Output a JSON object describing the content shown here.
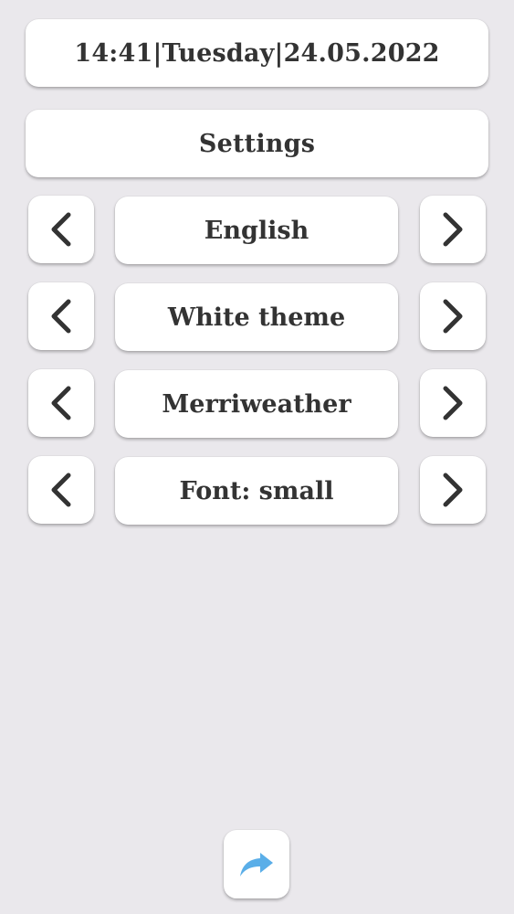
{
  "header": {
    "datetime": "14:41|Tuesday|24.05.2022"
  },
  "title": "Settings",
  "settings": [
    {
      "label": "English"
    },
    {
      "label": "White theme"
    },
    {
      "label": "Merriweather"
    },
    {
      "label": "Font: small"
    }
  ],
  "icons": {
    "previous": "chevron-left-icon",
    "next": "chevron-right-icon",
    "share": "share-arrow-icon"
  },
  "colors": {
    "background": "#eae8ec",
    "card": "#ffffff",
    "text": "#333333",
    "share_accent": "#5aaee8"
  }
}
